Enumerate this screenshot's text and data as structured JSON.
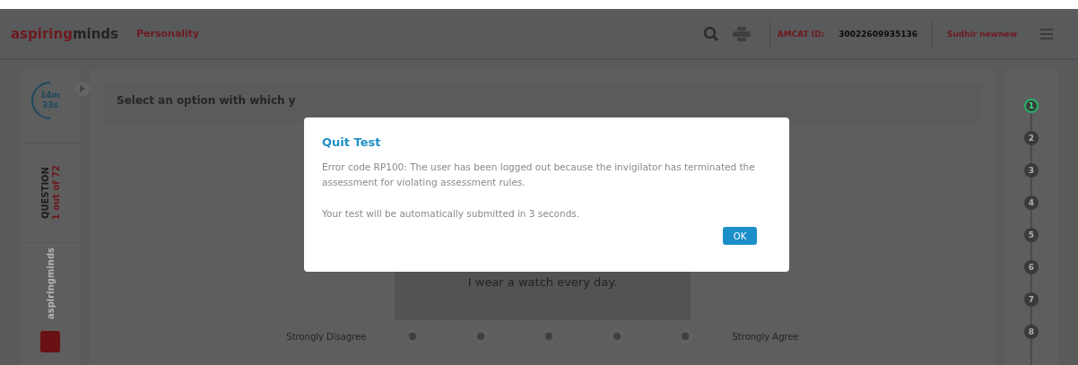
{
  "header": {
    "logo": {
      "first": "aspiring",
      "second": "minds"
    },
    "section": "Personality",
    "id_label": "AMCAT ID:",
    "id_value": "30022609935136",
    "user": "Sudhir newnew"
  },
  "sidebar": {
    "timer": {
      "minutes": "14m",
      "seconds": "33s"
    },
    "question_label": "QUESTION",
    "question_count": "1 out of 72",
    "logo": {
      "first": "aspiring",
      "second": "minds"
    }
  },
  "question": {
    "prompt": "Select an option with which y",
    "statement": "I wear a watch every day.",
    "scale_left": "Strongly Disagree",
    "scale_right": "Strongly Agree",
    "options": [
      {
        "selected": false
      },
      {
        "selected": false
      },
      {
        "selected": false
      },
      {
        "selected": false
      },
      {
        "selected": false
      }
    ]
  },
  "stepper": [
    {
      "label": "1",
      "selected": true
    },
    {
      "label": "2",
      "selected": false
    },
    {
      "label": "3",
      "selected": false
    },
    {
      "label": "4",
      "selected": false
    },
    {
      "label": "5",
      "selected": false
    },
    {
      "label": "6",
      "selected": false
    },
    {
      "label": "7",
      "selected": false
    },
    {
      "label": "8",
      "selected": false
    }
  ],
  "dialog": {
    "title": "Quit Test",
    "paragraphs": [
      "Error code RP100: The user has been logged out because the invigilator has terminated the assessment for violating assessment rules.",
      "Your test will be automatically submitted in 3 seconds."
    ],
    "button": "OK"
  }
}
